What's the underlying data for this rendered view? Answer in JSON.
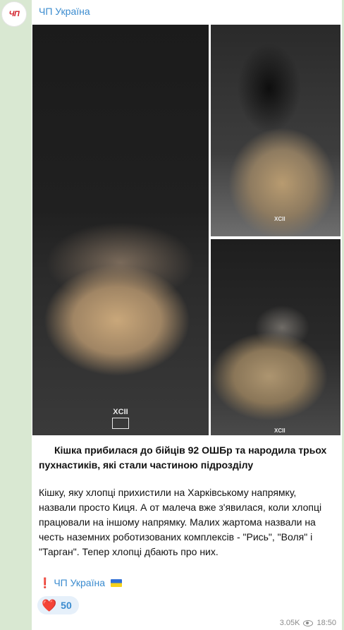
{
  "channel": {
    "avatar_text": "ЧП",
    "name": "ЧП Україна"
  },
  "post": {
    "title": "Кішка прибилася до бійців 92 ОШБр та народила трьох пухнастиків, які стали частиною підрозділу",
    "body": "Кішку, яку хлопці прихистили на Харківському напрямку, назвали просто Киця. А от малеча вже з'явилася, коли хлопці працювали на іншому напрямку. Малих жартома назвали на честь наземних роботизованих комплексів - \"Рись\", \"Воля\" і \"Тарган\". Тепер хлопці дбають про них.",
    "signature_mark": "❗",
    "signature": "ЧП Україна",
    "watermark": "XCII"
  },
  "reaction": {
    "emoji": "❤️",
    "count": "50"
  },
  "meta": {
    "views": "3.05K",
    "time": "18:50"
  }
}
